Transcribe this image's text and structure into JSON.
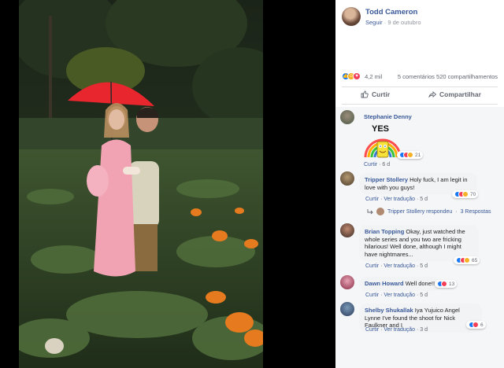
{
  "post": {
    "author": "Todd Cameron",
    "follow": "Seguir",
    "date": "9 de outubro",
    "reactions_count": "4,2 mil",
    "comments": "5 comentários",
    "shares": "520 compartilhamentos",
    "like_label": "Curtir",
    "share_label": "Compartilhar"
  },
  "comments": [
    {
      "name": "Stephanie Denny",
      "sticker_text": "YES",
      "reactions": "21",
      "actions": [
        "Curtir",
        "6 d"
      ]
    },
    {
      "name": "Tripper Stollery",
      "text": "Holy fuck, I am legit in love with you guys!",
      "reactions": "70",
      "actions": [
        "Curtir",
        "Ver tradução",
        "5 d"
      ],
      "reply_by": "Tripper Stollery respondeu",
      "reply_count": "3 Respostas"
    },
    {
      "name": "Brian Topping",
      "text": "Okay, just watched the whole series and you two are fricking hilarious! Well done, although I might have nightmares...",
      "reactions": "65",
      "actions": [
        "Curtir",
        "Ver tradução",
        "5 d"
      ]
    },
    {
      "name": "Dawn Howard",
      "text": "Well done!!",
      "reactions": "13",
      "actions": [
        "Curtir",
        "Ver tradução",
        "5 d"
      ]
    },
    {
      "name": "Shelby Shukallak",
      "text": "Iya Yujuico Angel Lynne I've found the shoot for Nick Faulkner and I",
      "reactions": "6",
      "actions": [
        "Curtir",
        "Ver tradução",
        "3 d"
      ]
    }
  ],
  "colors": {
    "link": "#385898",
    "like": "#1877f2",
    "love": "#f33e58",
    "haha": "#f7b125",
    "umbrella": "#e8262d",
    "dress": "#f2a3b3",
    "pumpkin": "#e57a1f"
  },
  "icons": {
    "like": "thumbs-up-icon",
    "share": "share-arrow-icon",
    "reply": "reply-arrow-icon"
  }
}
